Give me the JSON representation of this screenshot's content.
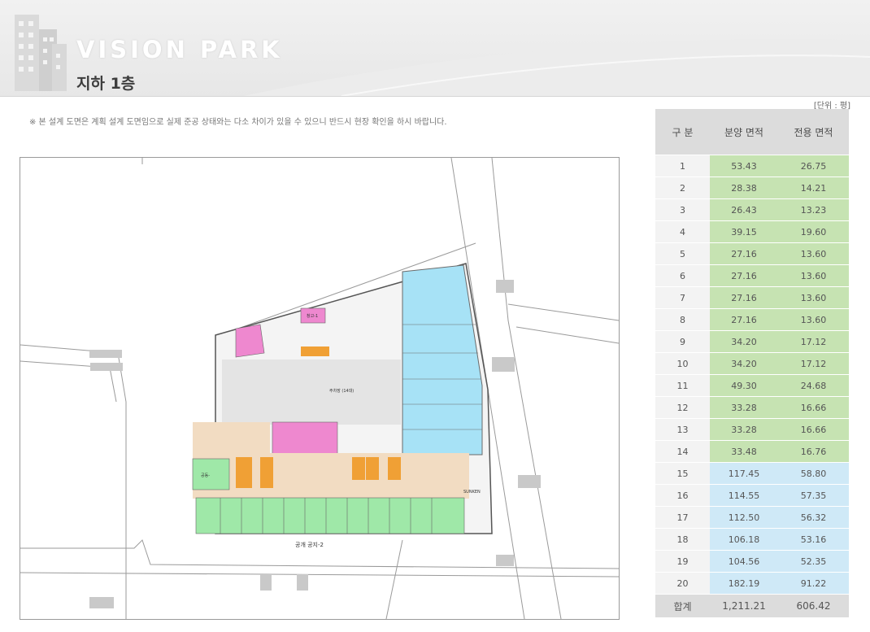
{
  "header": {
    "brand": "VISION PARK",
    "floor_title": "지하 1층"
  },
  "notice": "※ 본 설계 도면은 계획 설계 도면임으로 실제 준공 상태와는 다소 차이가 있을 수 있으니 반드시 현장 확인을 하시 바랍니다.",
  "unit_note": "[단위 : 평]",
  "plan": {
    "labels": {
      "public_space": "공개 공지-2",
      "sunken": "SUNKEN",
      "storage": "창고-1",
      "unit_shop": "공동-",
      "parking": "주차장 (14대)"
    }
  },
  "colors": {
    "retail": "#9fe8a8",
    "office": "#a7e2f6",
    "pink": "#ee88cf",
    "core": "#f0a035",
    "corridor": "#f2dcc2",
    "sale_cell": "#c6e3b2",
    "large_cell": "#cfe9f7"
  },
  "table": {
    "headers": [
      "구 분",
      "분양 면적",
      "전용 면적"
    ],
    "rows": [
      {
        "no": "1",
        "sale": "53.43",
        "private": "26.75",
        "group": "sale"
      },
      {
        "no": "2",
        "sale": "28.38",
        "private": "14.21",
        "group": "sale"
      },
      {
        "no": "3",
        "sale": "26.43",
        "private": "13.23",
        "group": "sale"
      },
      {
        "no": "4",
        "sale": "39.15",
        "private": "19.60",
        "group": "sale"
      },
      {
        "no": "5",
        "sale": "27.16",
        "private": "13.60",
        "group": "sale"
      },
      {
        "no": "6",
        "sale": "27.16",
        "private": "13.60",
        "group": "sale"
      },
      {
        "no": "7",
        "sale": "27.16",
        "private": "13.60",
        "group": "sale"
      },
      {
        "no": "8",
        "sale": "27.16",
        "private": "13.60",
        "group": "sale"
      },
      {
        "no": "9",
        "sale": "34.20",
        "private": "17.12",
        "group": "sale"
      },
      {
        "no": "10",
        "sale": "34.20",
        "private": "17.12",
        "group": "sale"
      },
      {
        "no": "11",
        "sale": "49.30",
        "private": "24.68",
        "group": "sale"
      },
      {
        "no": "12",
        "sale": "33.28",
        "private": "16.66",
        "group": "sale"
      },
      {
        "no": "13",
        "sale": "33.28",
        "private": "16.66",
        "group": "sale"
      },
      {
        "no": "14",
        "sale": "33.48",
        "private": "16.76",
        "group": "sale"
      },
      {
        "no": "15",
        "sale": "117.45",
        "private": "58.80",
        "group": "big"
      },
      {
        "no": "16",
        "sale": "114.55",
        "private": "57.35",
        "group": "big"
      },
      {
        "no": "17",
        "sale": "112.50",
        "private": "56.32",
        "group": "big"
      },
      {
        "no": "18",
        "sale": "106.18",
        "private": "53.16",
        "group": "big"
      },
      {
        "no": "19",
        "sale": "104.56",
        "private": "52.35",
        "group": "big"
      },
      {
        "no": "20",
        "sale": "182.19",
        "private": "91.22",
        "group": "big"
      }
    ],
    "total": {
      "label": "합계",
      "sale": "1,211.21",
      "private": "606.42"
    }
  }
}
